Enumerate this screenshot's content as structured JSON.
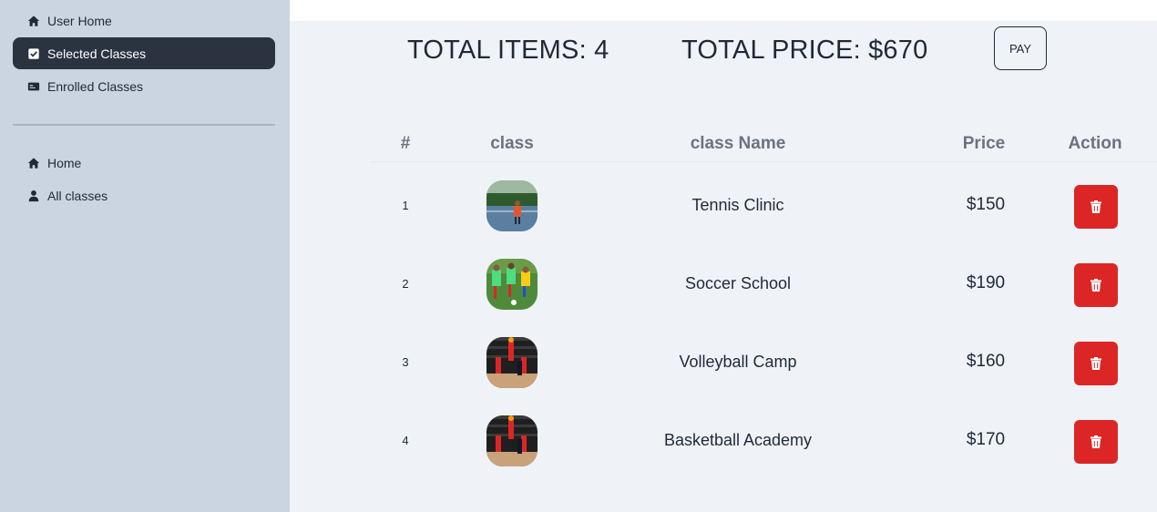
{
  "sidebar": {
    "top_items": [
      {
        "label": "User Home",
        "icon": "home-icon",
        "active": false
      },
      {
        "label": "Selected Classes",
        "icon": "checkbox-icon",
        "active": true
      },
      {
        "label": "Enrolled Classes",
        "icon": "card-icon",
        "active": false
      }
    ],
    "bottom_items": [
      {
        "label": "Home",
        "icon": "home-icon"
      },
      {
        "label": "All classes",
        "icon": "user-icon"
      }
    ]
  },
  "summary": {
    "total_items": "TOTAL ITEMS: 4",
    "total_price": "TOTAL PRICE: $670",
    "pay_label": "PAY"
  },
  "table": {
    "headers": [
      "#",
      "class",
      "class Name",
      "Price",
      "Action"
    ],
    "rows": [
      {
        "num": "1",
        "name": "Tennis Clinic",
        "price": "$150",
        "image": "tennis"
      },
      {
        "num": "2",
        "name": "Soccer School",
        "price": "$190",
        "image": "soccer"
      },
      {
        "num": "3",
        "name": "Volleyball Camp",
        "price": "$160",
        "image": "volleyball"
      },
      {
        "num": "4",
        "name": "Basketball Academy",
        "price": "$170",
        "image": "basketball"
      }
    ]
  },
  "colors": {
    "sidebar_bg": "#cbd5e1",
    "active_item_bg": "#2b3340",
    "main_bg": "#eff3f8",
    "delete_button": "#dc2626"
  }
}
